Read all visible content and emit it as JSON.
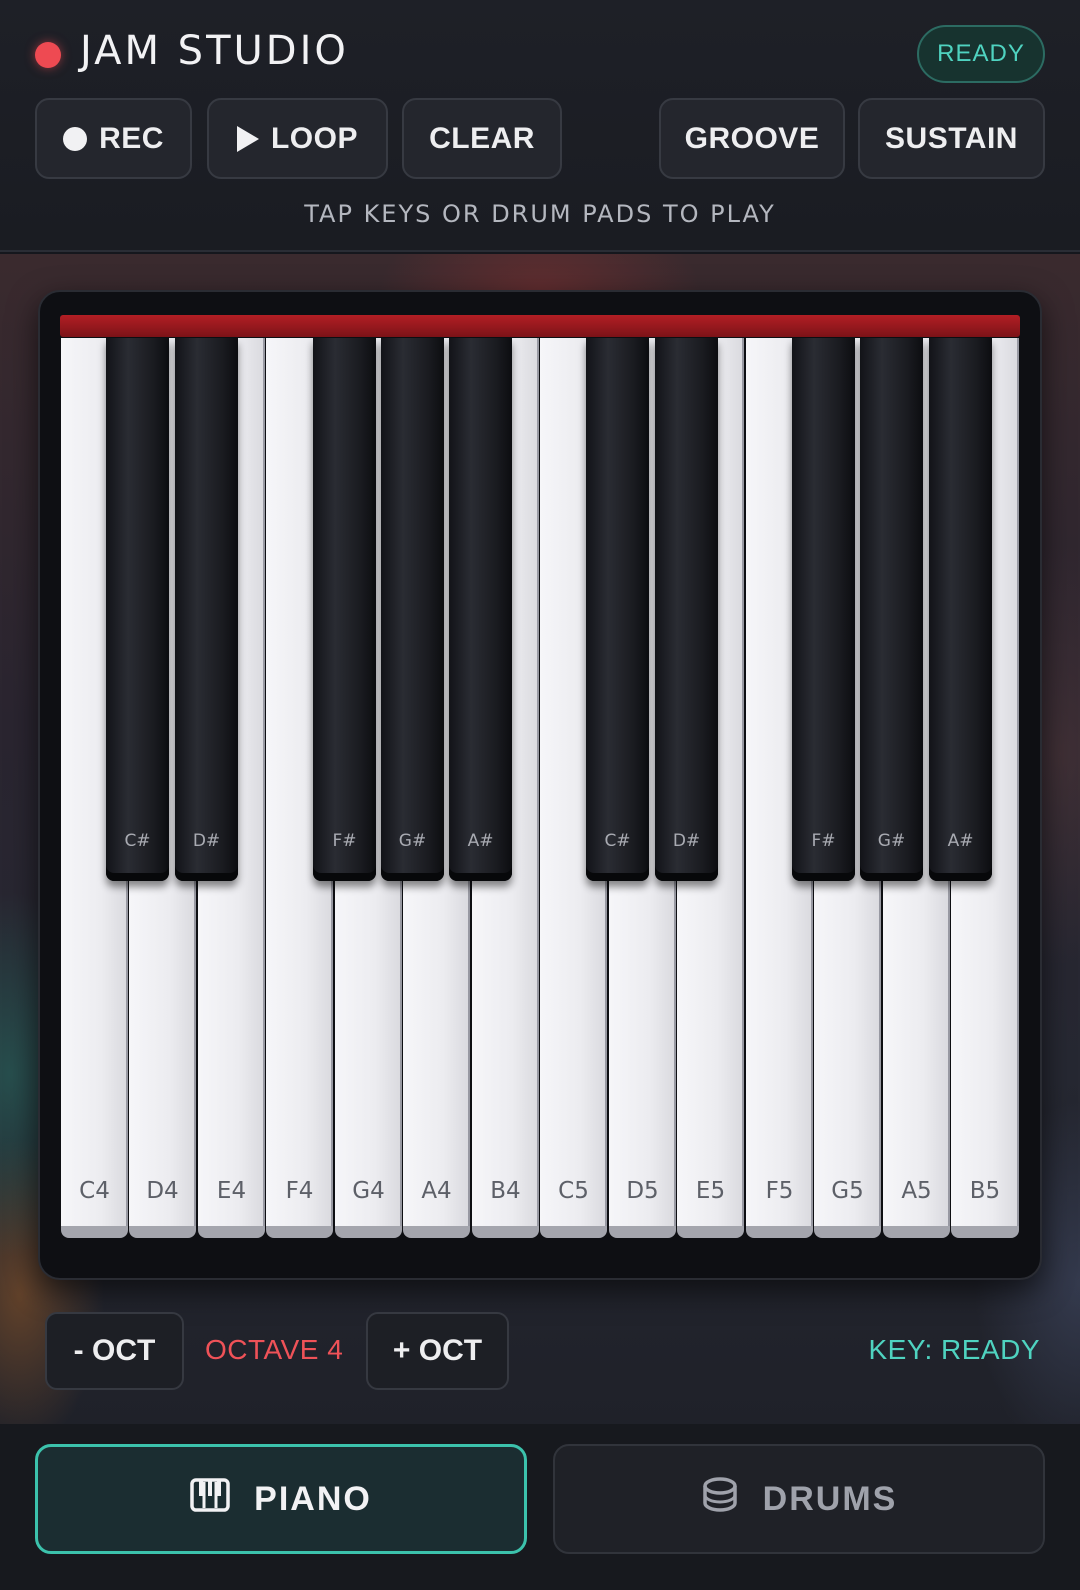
{
  "header": {
    "title": "JAM STUDIO",
    "status": "READY",
    "hint": "TAP KEYS OR DRUM PADS TO PLAY"
  },
  "toolbar": {
    "rec_label": "REC",
    "loop_label": "LOOP",
    "clear_label": "CLEAR",
    "groove_label": "GROOVE",
    "sustain_label": "SUSTAIN"
  },
  "piano": {
    "white_keys": [
      "C4",
      "D4",
      "E4",
      "F4",
      "G4",
      "A4",
      "B4",
      "C5",
      "D5",
      "E5",
      "F5",
      "G5",
      "A5",
      "B5"
    ],
    "black_keys": [
      "C#",
      "D#",
      "F#",
      "G#",
      "A#",
      "C#",
      "D#",
      "F#",
      "G#",
      "A#"
    ]
  },
  "octave_bar": {
    "down_label": "- OCT",
    "octave_label": "OCTAVE 4",
    "up_label": "+ OCT",
    "key_status": "KEY: READY"
  },
  "tabs": {
    "piano_label": "PIANO",
    "drums_label": "DRUMS",
    "piano_icon": "piano-keys-icon",
    "drums_icon": "drum-icon"
  },
  "colors": {
    "record_red": "#ee4a52",
    "accent_teal": "#4fd3c0",
    "octave_red": "#ef5258",
    "strip_red": "#b21e24"
  }
}
